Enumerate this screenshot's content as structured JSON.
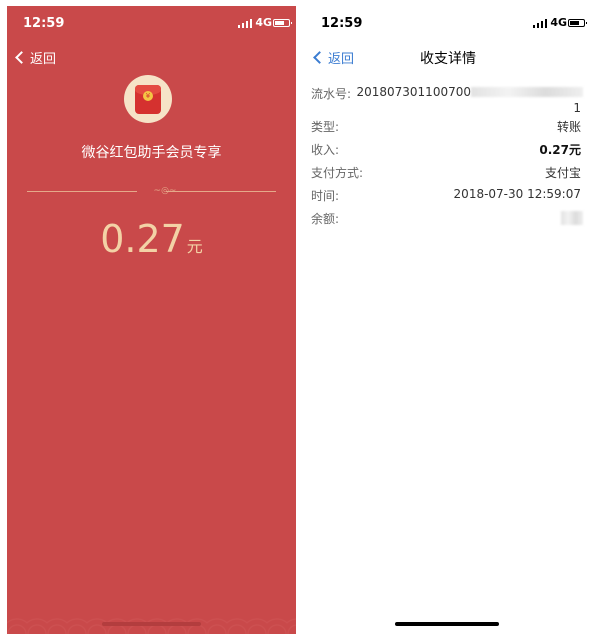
{
  "left": {
    "status": {
      "time": "12:59",
      "network": "4G"
    },
    "back_label": "返回",
    "title": "微谷红包助手会员专享",
    "amount": "0.27",
    "unit": "元",
    "envelope_glyph": "¥"
  },
  "right": {
    "status": {
      "time": "12:59",
      "network": "4G"
    },
    "back_label": "返回",
    "nav_title": "收支详情",
    "rows": [
      {
        "key": "流水号:",
        "value": "201807301100700",
        "value2": "1"
      },
      {
        "key": "类型:",
        "value": "转账"
      },
      {
        "key": "收入:",
        "value": "0.27元"
      },
      {
        "key": "支付方式:",
        "value": "支付宝"
      },
      {
        "key": "时间:",
        "value": "2018-07-30 12:59:07"
      },
      {
        "key": "余额:",
        "value": ""
      }
    ]
  },
  "colors": {
    "left_bg": "#c9494a",
    "amount": "#f3d2a6",
    "link": "#3b7cd1"
  }
}
